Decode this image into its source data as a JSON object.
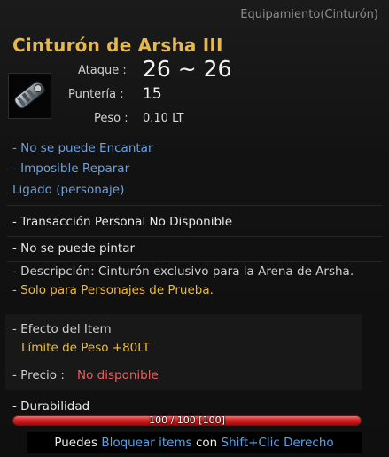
{
  "item": {
    "category": "Equipamiento(Cinturón)",
    "name": "Cinturón de Arsha III",
    "icon": "belt-icon"
  },
  "stats": {
    "attack_label": "Ataque :",
    "attack_value": "26 ~ 26",
    "accuracy_label": "Puntería :",
    "accuracy_value": "15",
    "weight_label": "Peso :",
    "weight_value": "0.10 LT"
  },
  "properties": {
    "no_enchant": "- No se puede Encantar",
    "no_repair": "- Imposible Reparar",
    "bound": "Ligado (personaje)",
    "no_trade": "- Transacción Personal No Disponible",
    "no_dye": "- No se puede pintar",
    "description": "- Descripción: Cinturón exclusivo para la Arena de Arsha.",
    "test_only": "- Solo para Personajes de Prueba."
  },
  "effect": {
    "title": "- Efecto del Item",
    "value": "Límite de Peso +80LT"
  },
  "price": {
    "label": "- Precio :",
    "value": "No disponible"
  },
  "durability": {
    "label": "- Durabilidad",
    "text": "100 / 100  [100]",
    "current": 100,
    "max": 100
  },
  "hint": {
    "part1": "Puedes ",
    "part2": "Bloquear items",
    "part3": " con ",
    "part4": "Shift+Clic Derecho"
  },
  "colors": {
    "name": "#e6b84c",
    "blue_text": "#6f9fd8",
    "yellow_text": "#e8bd3c",
    "red_text": "#e85f5f",
    "durability_bar": "#d42020"
  }
}
